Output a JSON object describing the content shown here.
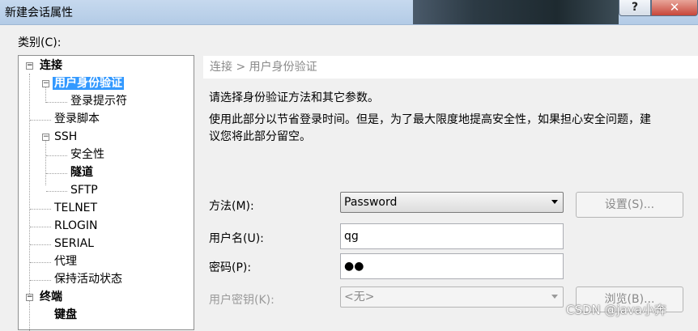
{
  "window": {
    "title": "新建会话属性",
    "help": "?",
    "close": "✕"
  },
  "category_label": "类别(C):",
  "tree": [
    {
      "label": "连接",
      "bold": true,
      "expander": "−"
    },
    {
      "label": "用户身份验证",
      "selected": true,
      "expander": "−"
    },
    {
      "label": "登录提示符"
    },
    {
      "label": "登录脚本"
    },
    {
      "label": "SSH",
      "expander": "−"
    },
    {
      "label": "安全性"
    },
    {
      "label": "隧道",
      "bold": true
    },
    {
      "label": "SFTP"
    },
    {
      "label": "TELNET"
    },
    {
      "label": "RLOGIN"
    },
    {
      "label": "SERIAL"
    },
    {
      "label": "代理"
    },
    {
      "label": "保持活动状态"
    },
    {
      "label": "终端",
      "bold": true,
      "expander": "−"
    },
    {
      "label": "键盘",
      "bold": true
    }
  ],
  "breadcrumb": "连接 > 用户身份验证",
  "desc1": "请选择身份验证方法和其它参数。",
  "desc2_line1": "使用此部分以节省登录时间。但是，为了最大限度地提高安全性，如果担心安全问题，建",
  "desc2_line2": "议您将此部分留空。",
  "form": {
    "method_label": "方法(M):",
    "method_value": "Password",
    "settings_button": "设置(S)...",
    "username_label": "用户名(U):",
    "username_value": "qg",
    "password_label": "密码(P):",
    "password_value": "●●",
    "userkey_label": "用户密钥(K):",
    "userkey_value": "<无>",
    "browse_button": "浏览(B)..."
  },
  "watermark": "CSDN @java小奔"
}
